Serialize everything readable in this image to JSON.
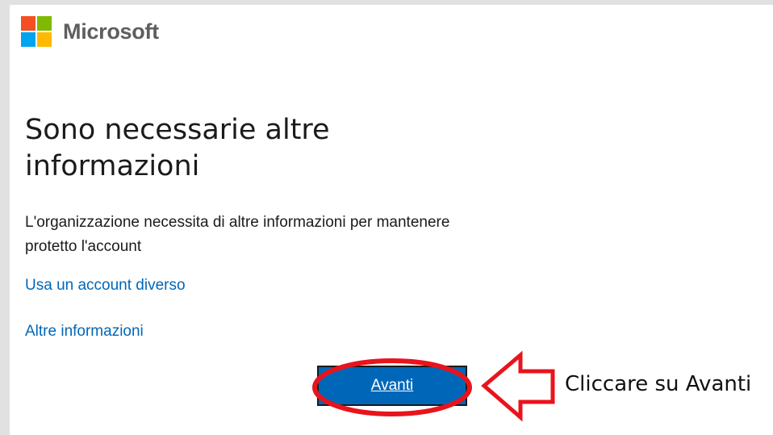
{
  "brand": {
    "name": "Microsoft",
    "colors": [
      "#f25022",
      "#7fba00",
      "#00a4ef",
      "#ffb900"
    ]
  },
  "page": {
    "title": "Sono necessarie altre informazioni",
    "description": "L'organizzazione necessita di altre informazioni per mantenere protetto l'account"
  },
  "links": {
    "different_account": "Usa un account diverso",
    "more_info": "Altre informazioni"
  },
  "buttons": {
    "next": "Avanti"
  },
  "annotation": {
    "text": "Cliccare su Avanti",
    "color": "#e8141c"
  },
  "accent_color": "#0067b8"
}
